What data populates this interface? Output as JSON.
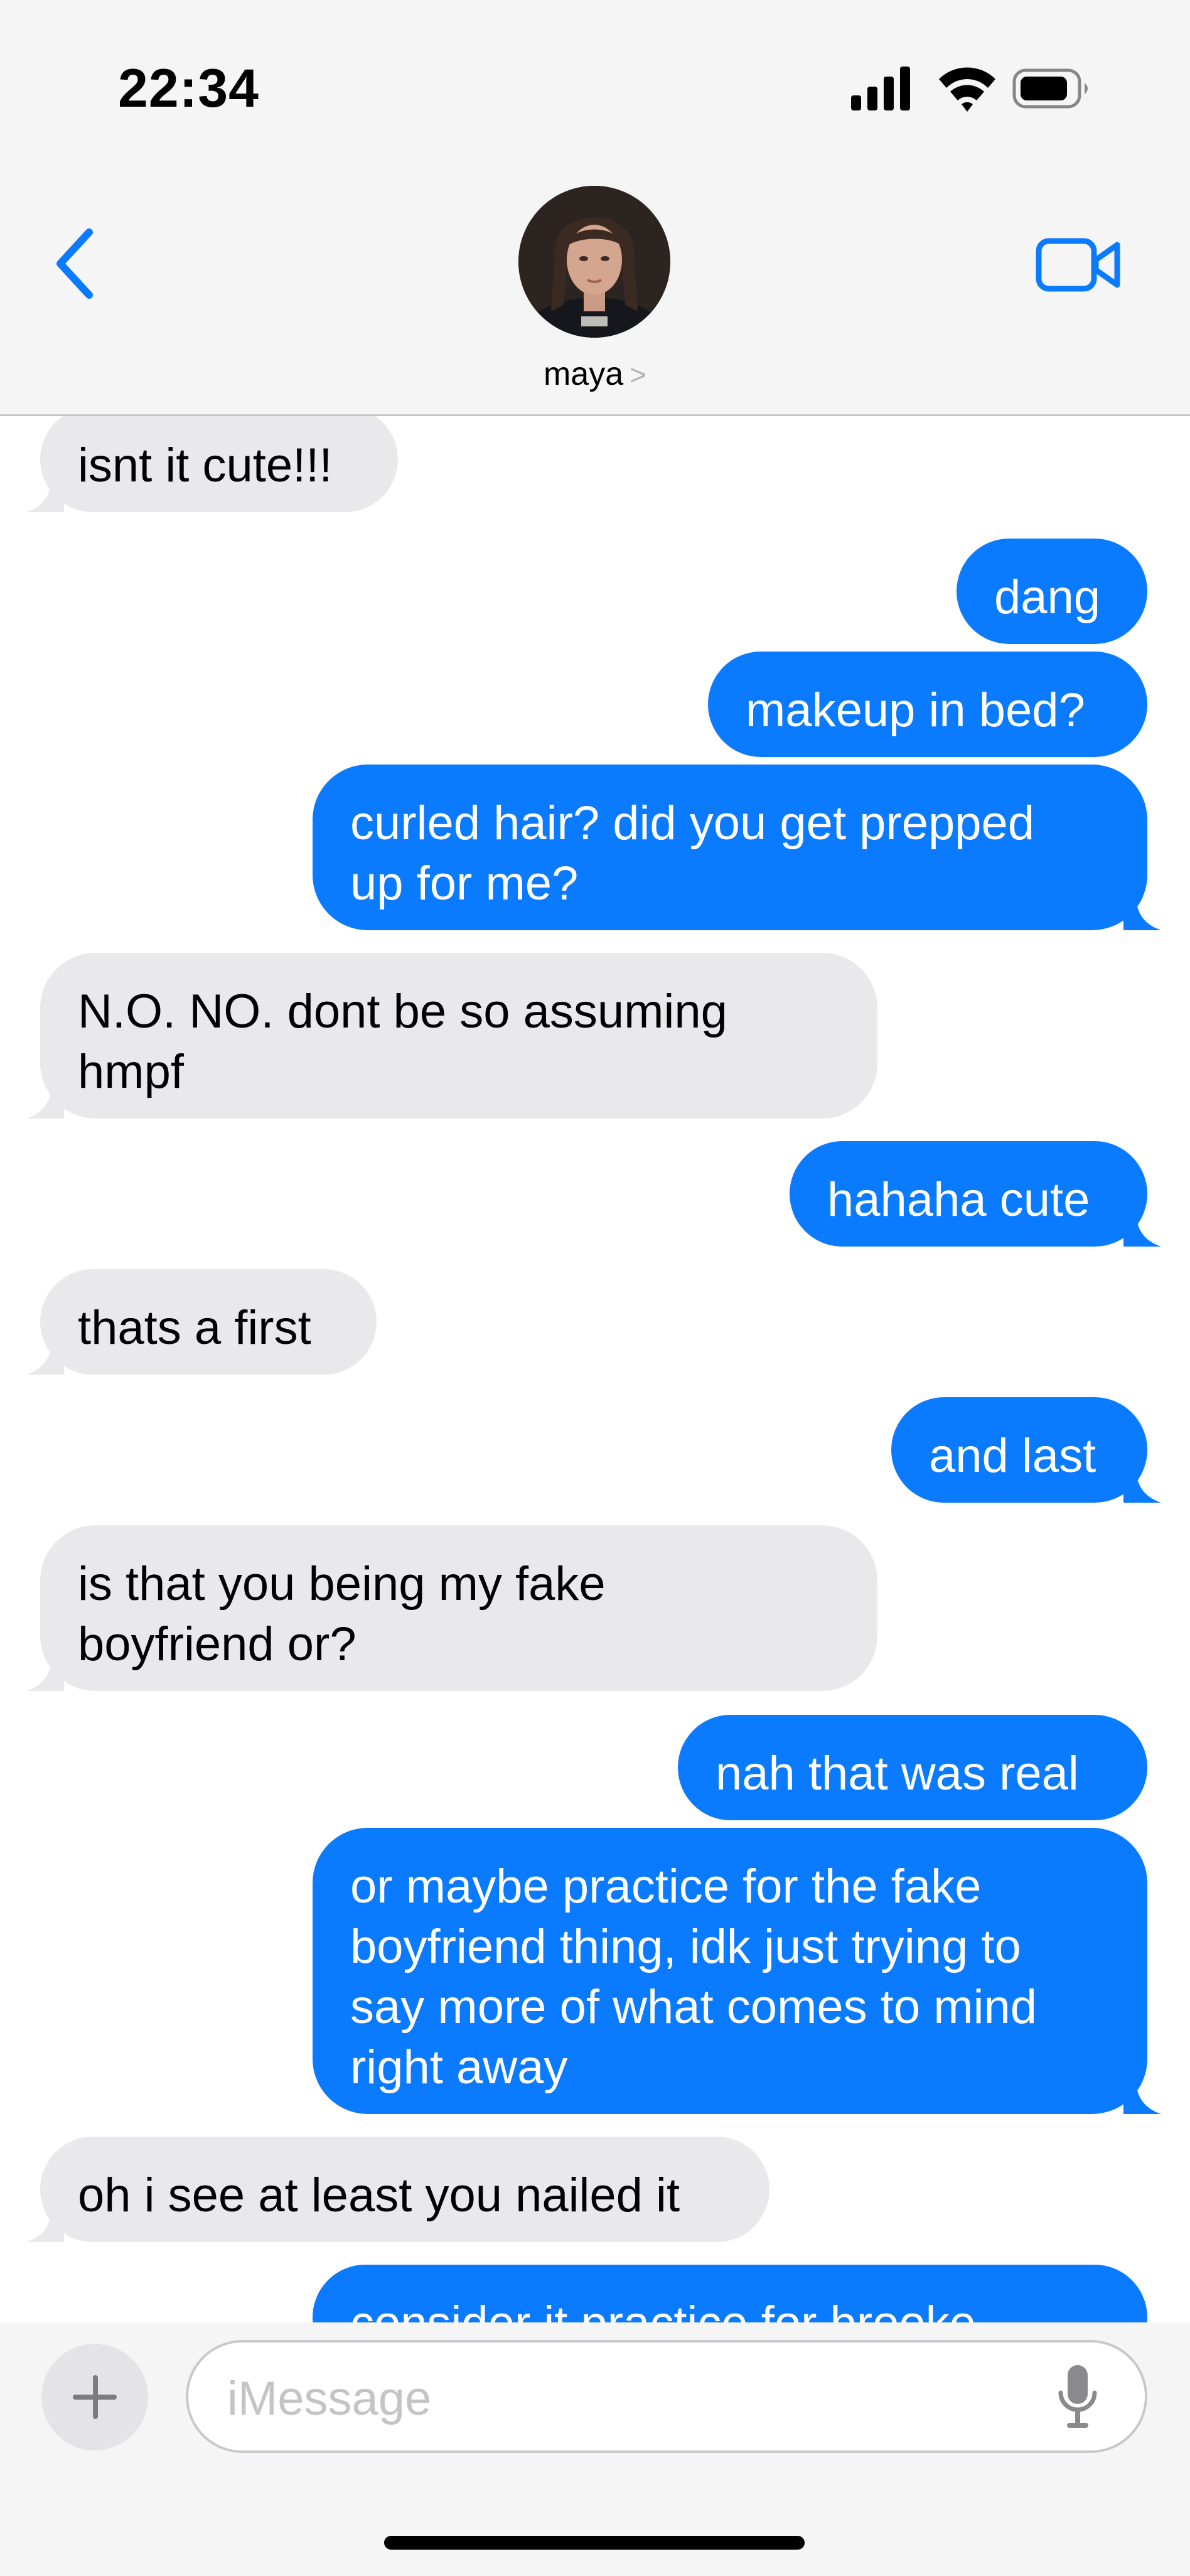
{
  "status_bar": {
    "time": "22:34",
    "battery_icon": "battery-icon",
    "wifi_icon": "wifi-icon",
    "signal_icon": "cellular-signal-icon"
  },
  "header": {
    "contact_name": "maya",
    "chevron": ">",
    "back_icon": "chevron-left-icon",
    "video_icon": "video-camera-icon",
    "accent": "#0a7aff"
  },
  "messages": [
    {
      "from": "them",
      "text": "isnt it cute!!!"
    },
    {
      "from": "me",
      "text": "dang"
    },
    {
      "from": "me",
      "text": "makeup in bed?"
    },
    {
      "from": "me",
      "lines": [
        "curled hair? did you get prepped",
        "up for me?"
      ]
    },
    {
      "from": "them",
      "lines": [
        "N.O. NO. dont be so assuming",
        "hmpf"
      ]
    },
    {
      "from": "me",
      "text": "hahaha cute"
    },
    {
      "from": "them",
      "text": "thats a first"
    },
    {
      "from": "me",
      "text": "and last"
    },
    {
      "from": "them",
      "lines": [
        "is that you being my fake",
        "boyfriend or?"
      ]
    },
    {
      "from": "me",
      "text": "nah that was real"
    },
    {
      "from": "me",
      "lines": [
        "or maybe practice for the fake",
        "boyfriend thing, idk just trying to",
        "say more of what comes to mind",
        "right away"
      ]
    },
    {
      "from": "them",
      "text": "oh i see at least you nailed it"
    },
    {
      "from": "me",
      "text": "consider it practice for brooke"
    }
  ],
  "composer": {
    "placeholder": "iMessage",
    "plus_icon": "plus-icon",
    "mic_icon": "microphone-icon"
  },
  "colors": {
    "incoming_bubble": "#e9e9eb",
    "outgoing_bubble": "#0a7aff",
    "header_bg": "#f5f5f5"
  }
}
